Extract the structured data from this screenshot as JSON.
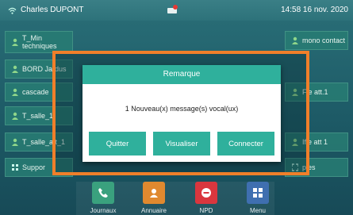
{
  "status": {
    "user": "Charles DUPONT",
    "datetime": "14:58  16 nov. 2020"
  },
  "lines_left": [
    "T_Min\ntechniques",
    "BORD Jardus",
    "cascade",
    "T_salle_1",
    "T_salle_att_1",
    "Suppor"
  ],
  "lines_right": [
    "mono contact",
    "Fle att.1",
    "Ifle att 1",
    "ples"
  ],
  "dialog": {
    "title": "Remarque",
    "message": "1 Nouveau(x) message(s) vocal(ux)",
    "buttons": [
      "Quitter",
      "Visualiser",
      "Connecter"
    ]
  },
  "dock": [
    "Journaux",
    "Annuaire",
    "NPD",
    "Menu"
  ],
  "colors": {
    "frame": "#f07f2a",
    "accent": "#2fb09c"
  }
}
